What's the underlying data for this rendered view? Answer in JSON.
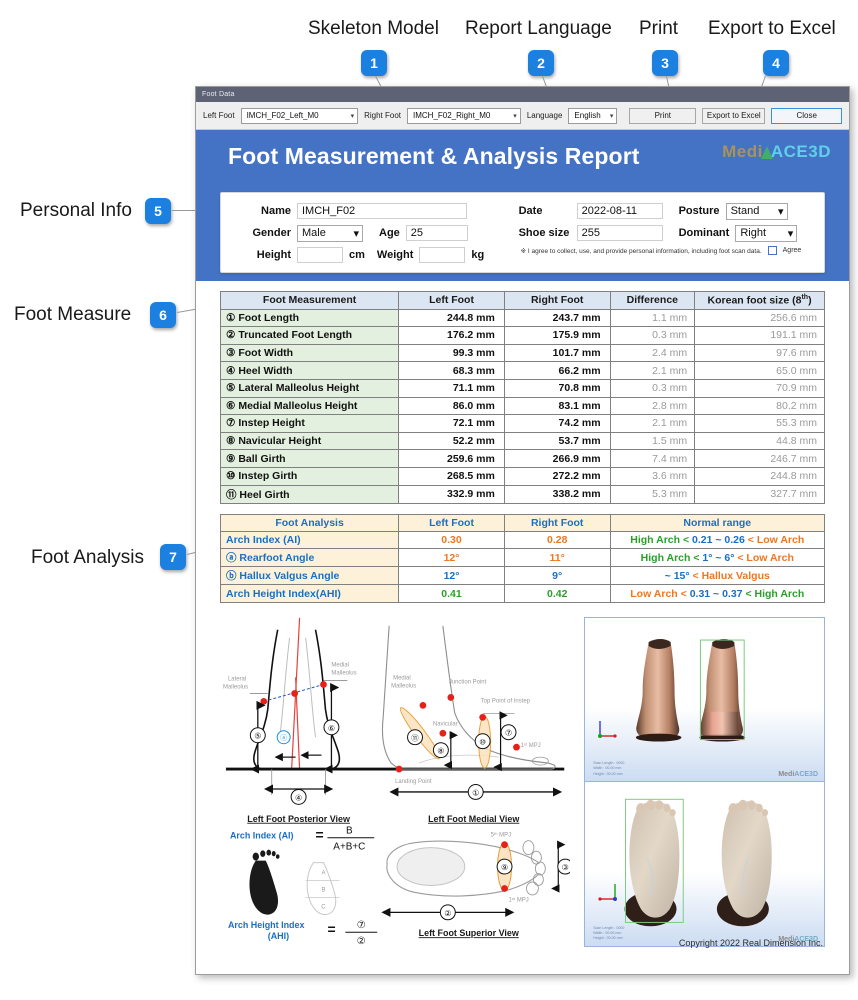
{
  "annotations": [
    {
      "id": "1",
      "label": "Skeleton Model"
    },
    {
      "id": "2",
      "label": "Report Language"
    },
    {
      "id": "3",
      "label": "Print"
    },
    {
      "id": "4",
      "label": "Export to Excel"
    },
    {
      "id": "5",
      "label": "Personal Info"
    },
    {
      "id": "6",
      "label": "Foot Measure"
    },
    {
      "id": "7",
      "label": "Foot Analysis"
    }
  ],
  "window": {
    "title": "Foot Data",
    "toolbar": {
      "left_foot_label": "Left Foot",
      "left_foot_value": "IMCH_F02_Left_M0",
      "right_foot_label": "Right Foot",
      "right_foot_value": "IMCH_F02_Right_M0",
      "language_label": "Language",
      "language_value": "English",
      "print_label": "Print",
      "export_label": "Export to Excel",
      "close_label": "Close"
    }
  },
  "report": {
    "title": "Foot Measurement & Analysis Report",
    "logo_medi": "Medi",
    "logo_ace": "ACE3D",
    "copyright": "Copyright 2022 Real Dimension Inc."
  },
  "personal_info": {
    "name_label": "Name",
    "name_value": "IMCH_F02",
    "gender_label": "Gender",
    "gender_value": "Male",
    "age_label": "Age",
    "age_value": "25",
    "height_label": "Height",
    "height_value": "",
    "height_unit": "cm",
    "weight_label": "Weight",
    "weight_value": "",
    "weight_unit": "kg",
    "date_label": "Date",
    "date_value": "2022-08-11",
    "posture_label": "Posture",
    "posture_value": "Stand",
    "shoe_size_label": "Shoe size",
    "shoe_size_value": "255",
    "dominant_label": "Dominant",
    "dominant_value": "Right",
    "consent_text": "※ I agree to collect, use, and provide personal information, including foot scan data.",
    "consent_agree_label": "Agree"
  },
  "measurement_table": {
    "headers": [
      "Foot Measurement",
      "Left Foot",
      "Right Foot",
      "Difference",
      "Korean foot size (8",
      "th",
      ")"
    ],
    "header_kor_base": "Korean foot size (8",
    "header_kor_sup": "th",
    "header_kor_tail": ")",
    "rows": [
      {
        "num": "①",
        "name": "Foot Length",
        "left": "244.8 mm",
        "right": "243.7 mm",
        "diff": "1.1 mm",
        "korean": "256.6 mm"
      },
      {
        "num": "②",
        "name": "Truncated Foot Length",
        "left": "176.2 mm",
        "right": "175.9 mm",
        "diff": "0.3 mm",
        "korean": "191.1 mm"
      },
      {
        "num": "③",
        "name": "Foot Width",
        "left": "99.3 mm",
        "right": "101.7 mm",
        "diff": "2.4 mm",
        "korean": "97.6 mm"
      },
      {
        "num": "④",
        "name": "Heel Width",
        "left": "68.3 mm",
        "right": "66.2 mm",
        "diff": "2.1 mm",
        "korean": "65.0 mm"
      },
      {
        "num": "⑤",
        "name": "Lateral Malleolus Height",
        "left": "71.1 mm",
        "right": "70.8 mm",
        "diff": "0.3 mm",
        "korean": "70.9 mm"
      },
      {
        "num": "⑥",
        "name": "Medial Malleolus Height",
        "left": "86.0 mm",
        "right": "83.1 mm",
        "diff": "2.8 mm",
        "korean": "80.2 mm"
      },
      {
        "num": "⑦",
        "name": "Instep Height",
        "left": "72.1 mm",
        "right": "74.2 mm",
        "diff": "2.1 mm",
        "korean": "55.3 mm"
      },
      {
        "num": "⑧",
        "name": "Navicular Height",
        "left": "52.2 mm",
        "right": "53.7 mm",
        "diff": "1.5 mm",
        "korean": "44.8 mm"
      },
      {
        "num": "⑨",
        "name": "Ball Girth",
        "left": "259.6 mm",
        "right": "266.9 mm",
        "diff": "7.4 mm",
        "korean": "246.7 mm"
      },
      {
        "num": "⑩",
        "name": "Instep Girth",
        "left": "268.5 mm",
        "right": "272.2 mm",
        "diff": "3.6 mm",
        "korean": "244.8 mm"
      },
      {
        "num": "⑪",
        "name": "Heel Girth",
        "left": "332.9 mm",
        "right": "338.2 mm",
        "diff": "5.3 mm",
        "korean": "327.7 mm"
      }
    ]
  },
  "analysis_table": {
    "headers": [
      "Foot Analysis",
      "Left Foot",
      "Right Foot",
      "Normal range"
    ],
    "rows": [
      {
        "num": "",
        "name": "Arch Index (AI)",
        "left": "0.30",
        "right": "0.28",
        "value_color": "#ef7722",
        "range_parts": [
          {
            "text": "High Arch < ",
            "color": "#2aa02a"
          },
          {
            "text": "0.21 ~ 0.26",
            "color": "#1a6fc4"
          },
          {
            "text": " < Low Arch",
            "color": "#ef7722"
          }
        ]
      },
      {
        "num": "ⓐ",
        "name": "Rearfoot Angle",
        "left": "12°",
        "right": "11°",
        "value_color": "#ef7722",
        "range_parts": [
          {
            "text": "High Arch < ",
            "color": "#2aa02a"
          },
          {
            "text": "1° ~ 6°",
            "color": "#1a6fc4"
          },
          {
            "text": " < Low Arch",
            "color": "#ef7722"
          }
        ]
      },
      {
        "num": "ⓑ",
        "name": "Hallux Valgus Angle",
        "left": "12°",
        "right": "9°",
        "value_color": "#1a6fc4",
        "range_parts": [
          {
            "text": "~ 15°",
            "color": "#1a6fc4"
          },
          {
            "text": " < Hallux Valgus",
            "color": "#ef7722"
          }
        ]
      },
      {
        "num": "",
        "name": "Arch Height Index(AHI)",
        "left": "0.41",
        "right": "0.42",
        "value_color": "#2aa02a",
        "range_parts": [
          {
            "text": "Low Arch < ",
            "color": "#ef7722"
          },
          {
            "text": "0.31 ~ 0.37",
            "color": "#1a6fc4"
          },
          {
            "text": " < High Arch",
            "color": "#2aa02a"
          }
        ]
      }
    ]
  },
  "diagrams": {
    "posterior_caption": "Left Foot Posterior View",
    "medial_caption": "Left Foot Medial View",
    "superior_caption": "Left Foot Superior View",
    "labels": {
      "lateral_malleolus": "Lateral\nMalleolus",
      "lateral_malleolus_l1": "Lateral",
      "lateral_malleolus_l2": "Malleolus",
      "medial_malleolus_l1": "Medial",
      "medial_malleolus_l2": "Malleolus",
      "junction_point": "Junction Point",
      "top_point_instep": "Top Point of Instep",
      "navicular": "Navicular",
      "landing_point": "Landing Point",
      "mpj1": "1ˢᵗ MPJ",
      "mpj5": "5ᵗʰ MPJ"
    },
    "arch_index_eq": {
      "name_l1": "Arch Index (AI)",
      "equals": "=",
      "numerator": "B",
      "denominator": "A+B+C"
    },
    "ahi_eq": {
      "name_l1": "Arch Height Index",
      "name_l2": "(AHI)",
      "equals": "=",
      "numerator": "⑦",
      "denominator": "②"
    },
    "markers": {
      "m1": "①",
      "m2": "②",
      "m3": "③",
      "m4": "④",
      "m5": "⑤",
      "m6": "⑥",
      "m7": "⑦",
      "m8": "⑧",
      "m9": "⑨",
      "m10": "⑩",
      "m11": "⑪",
      "ma": "ⓐ",
      "mb": "ⓑ"
    }
  },
  "scan_panel": {
    "watermark_medi": "Medi",
    "watermark_ace": "ACE3D",
    "meta_line1": "Scan Length : 0000",
    "meta_line2": "Width : 00.00 mm",
    "meta_line3": "Height : 00.00 mm"
  },
  "colors": {
    "brand_blue": "#4472c4",
    "badge_blue": "#1b80e0",
    "measure_header": "#dce6f2",
    "measure_name_bg": "#e4f0df",
    "analysis_bg": "#fdf2d9",
    "accent_orange": "#ef7722",
    "accent_green": "#2aa02a",
    "accent_blue_text": "#1a6fc4"
  }
}
